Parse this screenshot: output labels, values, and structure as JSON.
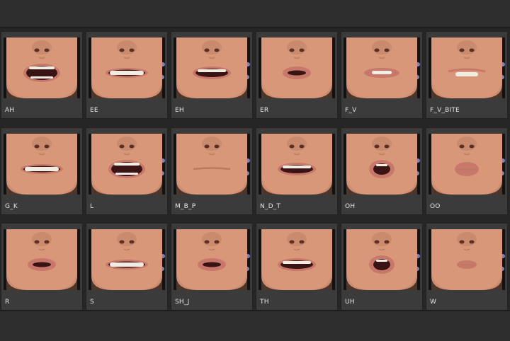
{
  "visemes": [
    {
      "label": "AH",
      "mouth": "wide-open"
    },
    {
      "label": "EE",
      "mouth": "wide-teeth"
    },
    {
      "label": "EH",
      "mouth": "open-teeth"
    },
    {
      "label": "ER",
      "mouth": "round-small"
    },
    {
      "label": "F_V",
      "mouth": "teeth-lip"
    },
    {
      "label": "F_V_BITE",
      "mouth": "lip-bite"
    },
    {
      "label": "G_K",
      "mouth": "wide-teeth"
    },
    {
      "label": "L",
      "mouth": "wide-open"
    },
    {
      "label": "M_B_P",
      "mouth": "closed"
    },
    {
      "label": "N_D_T",
      "mouth": "open-teeth"
    },
    {
      "label": "OH",
      "mouth": "round-open"
    },
    {
      "label": "OO",
      "mouth": "pucker"
    },
    {
      "label": "R",
      "mouth": "round-small"
    },
    {
      "label": "S",
      "mouth": "wide-teeth"
    },
    {
      "label": "SH_J",
      "mouth": "round-small"
    },
    {
      "label": "TH",
      "mouth": "open-teeth"
    },
    {
      "label": "UH",
      "mouth": "round-open"
    },
    {
      "label": "W",
      "mouth": "closed-small"
    }
  ],
  "colors": {
    "skin": "#d9977a",
    "skin_shadow": "#b97a5f",
    "lip": "#c8786a",
    "mouth_dark": "#3a1414",
    "teeth": "#f2ede2",
    "background_flower": "#9a8fe8"
  }
}
